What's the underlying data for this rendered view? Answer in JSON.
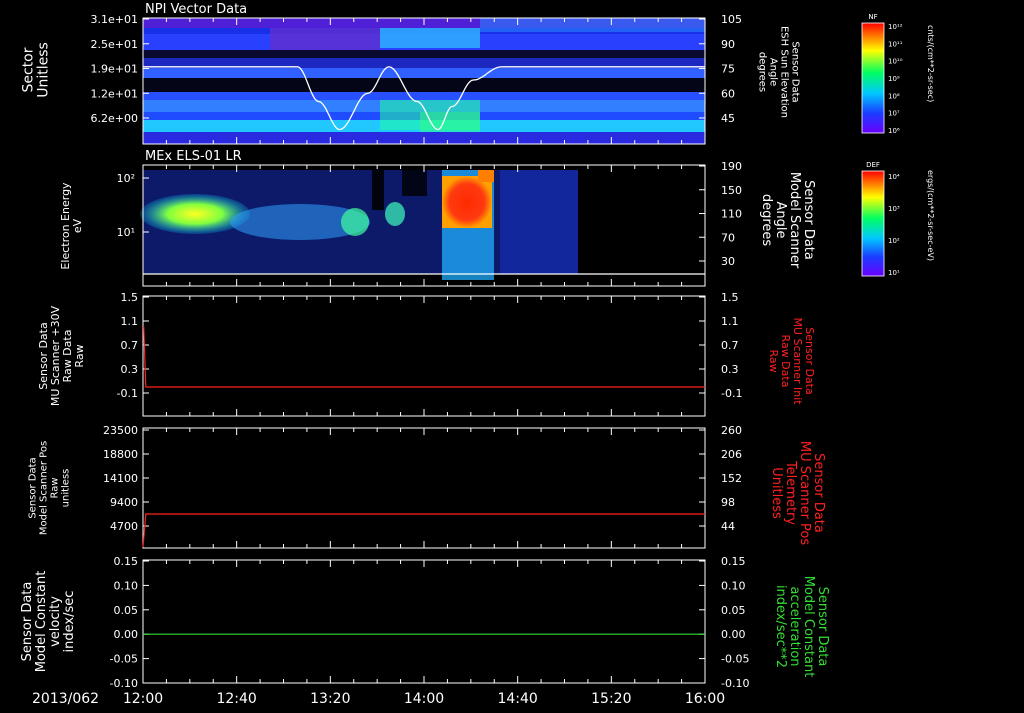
{
  "date": "2013/062",
  "time_ticks": [
    "12:00",
    "12:40",
    "13:20",
    "14:00",
    "14:40",
    "15:20",
    "16:00"
  ],
  "chart_data": [
    {
      "type": "heatmap",
      "title": "NPI Vector Data",
      "ylabel": [
        "Sector",
        "Unitless"
      ],
      "yticks": [
        "3.1e+01",
        "2.5e+01",
        "1.9e+01",
        "1.2e+01",
        "6.2e+00"
      ],
      "yticks_values": [
        31,
        25,
        19,
        12,
        6.2
      ],
      "right_axis_label": [
        "Sensor Data",
        "ESH Sun Elevation",
        "Angle",
        "degrees"
      ],
      "right_yticks": [
        "105",
        "90",
        "75",
        "60",
        "45"
      ],
      "right_yticks_values": [
        105,
        90,
        75,
        60,
        45
      ],
      "overlay_series": {
        "name": "ESH Sun Elevation",
        "time_hours": [
          12.0,
          13.1,
          13.25,
          13.4,
          13.6,
          13.75,
          13.95,
          14.1,
          14.2,
          14.35,
          14.55,
          16.0
        ],
        "values": [
          76,
          76,
          55,
          38,
          60,
          76,
          55,
          38,
          52,
          68,
          76,
          76
        ]
      },
      "colorbar": {
        "label": "NF",
        "units": "cnts/(cm**2-sr-sec)",
        "ticks": [
          "10¹²",
          "10¹¹",
          "10¹⁰",
          "10⁹",
          "10⁸",
          "10⁷",
          "10⁶"
        ]
      }
    },
    {
      "type": "heatmap",
      "title": "MEx ELS-01 LR",
      "ylabel": [
        "Electron Energy",
        "eV"
      ],
      "yticks": [
        "10²",
        "10¹"
      ],
      "yticks_values": [
        100,
        10
      ],
      "right_axis_label": [
        "Sensor Data",
        "Model Scanner",
        "Angle",
        "degrees"
      ],
      "right_yticks": [
        "190",
        "150",
        "110",
        "70",
        "30"
      ],
      "right_yticks_values": [
        190,
        150,
        110,
        70,
        30
      ],
      "overlay_series": {
        "name": "Model Scanner Angle",
        "time_hours": [
          12.0,
          16.0
        ],
        "values": [
          18,
          18
        ]
      },
      "colorbar": {
        "label": "DEF",
        "units": "ergs/(cm**2-sr-sec-eV)",
        "ticks": [
          "10⁴",
          "10³",
          "10²",
          "10¹"
        ]
      }
    },
    {
      "type": "line",
      "ylabel": [
        "Sensor Data",
        "MU Scanner +30V",
        "Raw Data",
        "Raw"
      ],
      "yticks": [
        "1.5",
        "1.1",
        "0.7",
        "0.3",
        "-0.1"
      ],
      "ylim": [
        -0.3,
        1.5
      ],
      "right_axis_label": [
        "Sensor Data",
        "MU Scanner Init",
        "Raw Data",
        "Raw"
      ],
      "right_yticks": [
        "1.5",
        "1.1",
        "0.7",
        "0.3",
        "-0.1"
      ],
      "series": [
        {
          "name": "MU Scanner Init Raw Data",
          "color": "#ff2020",
          "time_hours": [
            12.0,
            12.005,
            12.02,
            16.0
          ],
          "values": [
            1.0,
            1.0,
            0.0,
            0.0
          ]
        }
      ]
    },
    {
      "type": "line",
      "ylabel": [
        "Sensor Data",
        "Model Scanner Pos",
        "Raw",
        "unitless"
      ],
      "yticks": [
        "23500",
        "18800",
        "14100",
        "9400",
        "4700"
      ],
      "ylim": [
        0,
        23500
      ],
      "right_axis_label": [
        "Sensor Data",
        "MU Scanner Pos",
        "Telemetry",
        "Unitless"
      ],
      "right_yticks": [
        "260",
        "206",
        "152",
        "98",
        "44"
      ],
      "series": [
        {
          "name": "MU Scanner Pos Telemetry",
          "color": "#ff2020",
          "time_hours": [
            12.0,
            12.02,
            16.0
          ],
          "values": [
            0,
            7050,
            7050
          ]
        }
      ]
    },
    {
      "type": "line",
      "ylabel": [
        "Sensor Data",
        "Model Constant",
        "velocity",
        "index/sec"
      ],
      "yticks": [
        "0.15",
        "0.10",
        "0.05",
        "0.00",
        "-0.05",
        "-0.10"
      ],
      "ylim": [
        -0.1,
        0.15
      ],
      "right_axis_label": [
        "Sensor Data",
        "Model Constant",
        "acceleration",
        "index/sec**2"
      ],
      "right_yticks": [
        "0.15",
        "0.10",
        "0.05",
        "0.00",
        "-0.05",
        "-0.10"
      ],
      "series": [
        {
          "name": "Model Constant acceleration",
          "color": "#33dd33",
          "time_hours": [
            12.0,
            16.0
          ],
          "values": [
            0,
            0
          ]
        }
      ]
    }
  ]
}
